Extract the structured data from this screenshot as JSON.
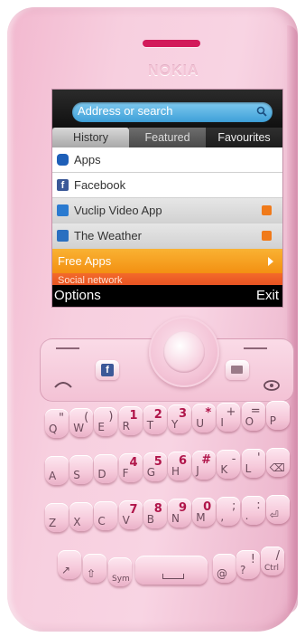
{
  "device": {
    "brand": "NOKIA"
  },
  "browser": {
    "address_placeholder": "Address or search",
    "tabs": [
      {
        "label": "History",
        "selected": false
      },
      {
        "label": "Featured",
        "selected": true
      },
      {
        "label": "Favourites",
        "selected": false
      }
    ],
    "items": [
      {
        "label": "Apps",
        "icon": "apps-icon",
        "color": "#1e5fb8"
      },
      {
        "label": "Facebook",
        "icon": "facebook-icon",
        "color": "#3b5998"
      },
      {
        "label": "Vuclip Video App",
        "icon": "vuclip-icon",
        "color": "#2a7ad0"
      },
      {
        "label": "The Weather",
        "icon": "weather-icon",
        "color": "#2a6fc0"
      },
      {
        "label": "Free Apps",
        "icon": "chevron-right-icon",
        "color": "#f39a1e"
      },
      {
        "label": "Social network",
        "icon": "",
        "color": "#e8552a"
      }
    ],
    "softkeys": {
      "left": "Options",
      "right": "Exit"
    }
  },
  "keypad": {
    "row1": [
      {
        "main": "Q",
        "alt": "\""
      },
      {
        "main": "W",
        "alt": "("
      },
      {
        "main": "E",
        "alt": ")"
      },
      {
        "main": "R",
        "alt": "1"
      },
      {
        "main": "T",
        "alt": "2"
      },
      {
        "main": "Y",
        "alt": "3"
      },
      {
        "main": "U",
        "alt": "*"
      },
      {
        "main": "I",
        "alt": "+"
      },
      {
        "main": "O",
        "alt": "="
      },
      {
        "main": "P",
        "alt": ""
      }
    ],
    "row2": [
      {
        "main": "A",
        "alt": ""
      },
      {
        "main": "S",
        "alt": ""
      },
      {
        "main": "D",
        "alt": ""
      },
      {
        "main": "F",
        "alt": "4"
      },
      {
        "main": "G",
        "alt": "5"
      },
      {
        "main": "H",
        "alt": "6"
      },
      {
        "main": "J",
        "alt": "#"
      },
      {
        "main": "K",
        "alt": "-"
      },
      {
        "main": "L",
        "alt": "'"
      },
      {
        "main": "⌫",
        "alt": ""
      }
    ],
    "row3": [
      {
        "main": "Z",
        "alt": ""
      },
      {
        "main": "X",
        "alt": ""
      },
      {
        "main": "C",
        "alt": ""
      },
      {
        "main": "V",
        "alt": "7"
      },
      {
        "main": "B",
        "alt": "8"
      },
      {
        "main": "N",
        "alt": "9"
      },
      {
        "main": "M",
        "alt": "0"
      },
      {
        "main": ",",
        "alt": ";"
      },
      {
        "main": ".",
        "alt": ":"
      },
      {
        "main": "⏎",
        "alt": ""
      }
    ],
    "row4": [
      {
        "main": "↗",
        "alt": ""
      },
      {
        "main": "⇧",
        "alt": ""
      },
      {
        "main": "Sym",
        "alt": ""
      },
      {
        "main": "@",
        "alt": ""
      },
      {
        "main": "?",
        "alt": "!"
      },
      {
        "main": "Ctrl",
        "alt": "/"
      }
    ]
  }
}
